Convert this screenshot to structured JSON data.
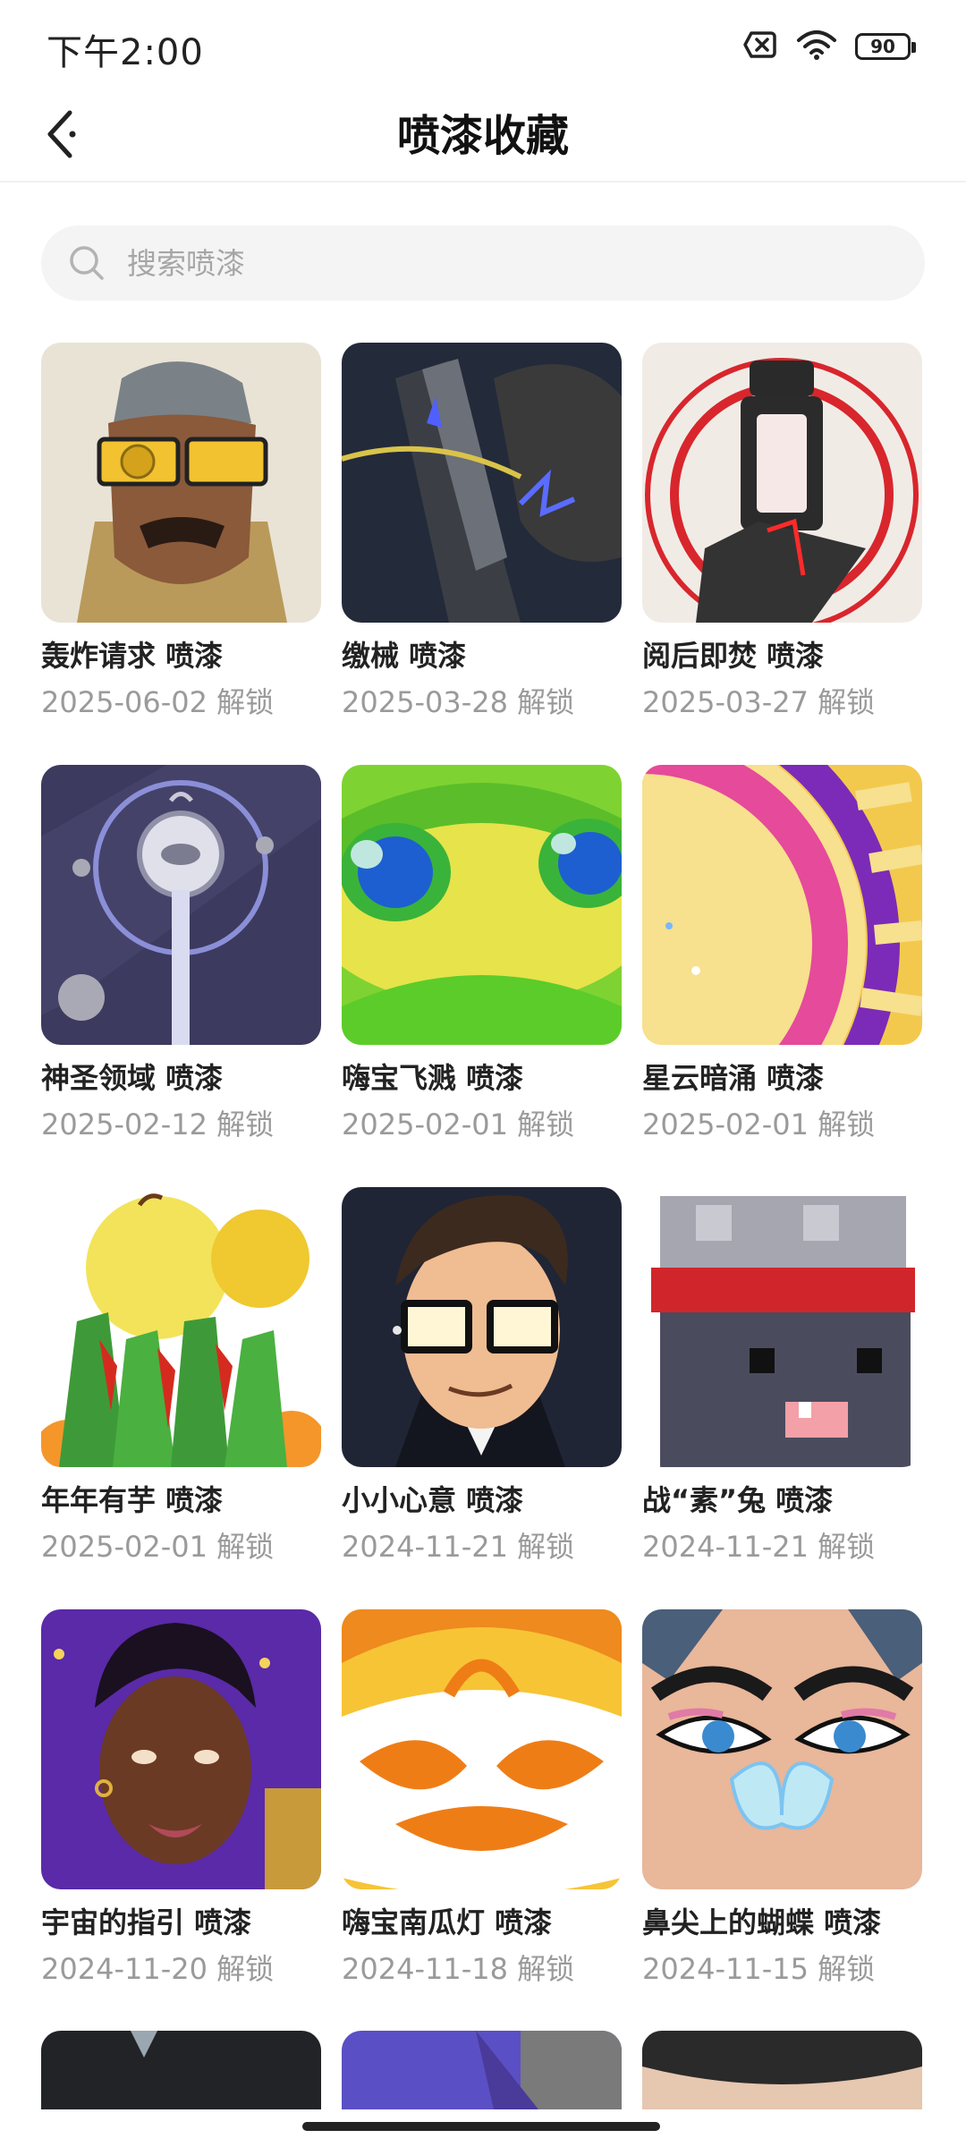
{
  "status_bar": {
    "time": "下午2:00",
    "battery": "90",
    "icons": [
      "sim-off-icon",
      "wifi-icon",
      "battery-icon"
    ]
  },
  "header": {
    "title": "喷漆收藏",
    "back_icon": "chevron-left-icon"
  },
  "search": {
    "placeholder": "搜索喷漆"
  },
  "sprays": [
    {
      "name": "轰炸请求 喷漆",
      "date": "2025-06-02 解锁"
    },
    {
      "name": "缴械 喷漆",
      "date": "2025-03-28 解锁"
    },
    {
      "name": "阅后即焚 喷漆",
      "date": "2025-03-27 解锁"
    },
    {
      "name": "神圣领域 喷漆",
      "date": "2025-02-12 解锁"
    },
    {
      "name": "嗨宝飞溅 喷漆",
      "date": "2025-02-01 解锁"
    },
    {
      "name": "星云暗涌 喷漆",
      "date": "2025-02-01 解锁"
    },
    {
      "name": "年年有芋 喷漆",
      "date": "2025-02-01 解锁"
    },
    {
      "name": "小小心意 喷漆",
      "date": "2024-11-21 解锁"
    },
    {
      "name": "战“素”兔 喷漆",
      "date": "2024-11-21 解锁"
    },
    {
      "name": "宇宙的指引 喷漆",
      "date": "2024-11-20 解锁"
    },
    {
      "name": "嗨宝南瓜灯 喷漆",
      "date": "2024-11-18 解锁"
    },
    {
      "name": "鼻尖上的蝴蝶 喷漆",
      "date": "2024-11-15 解锁"
    }
  ],
  "colors": {
    "background": "#ffffff",
    "search_bg": "#f4f4f4",
    "date_text": "#9a9a9a"
  }
}
